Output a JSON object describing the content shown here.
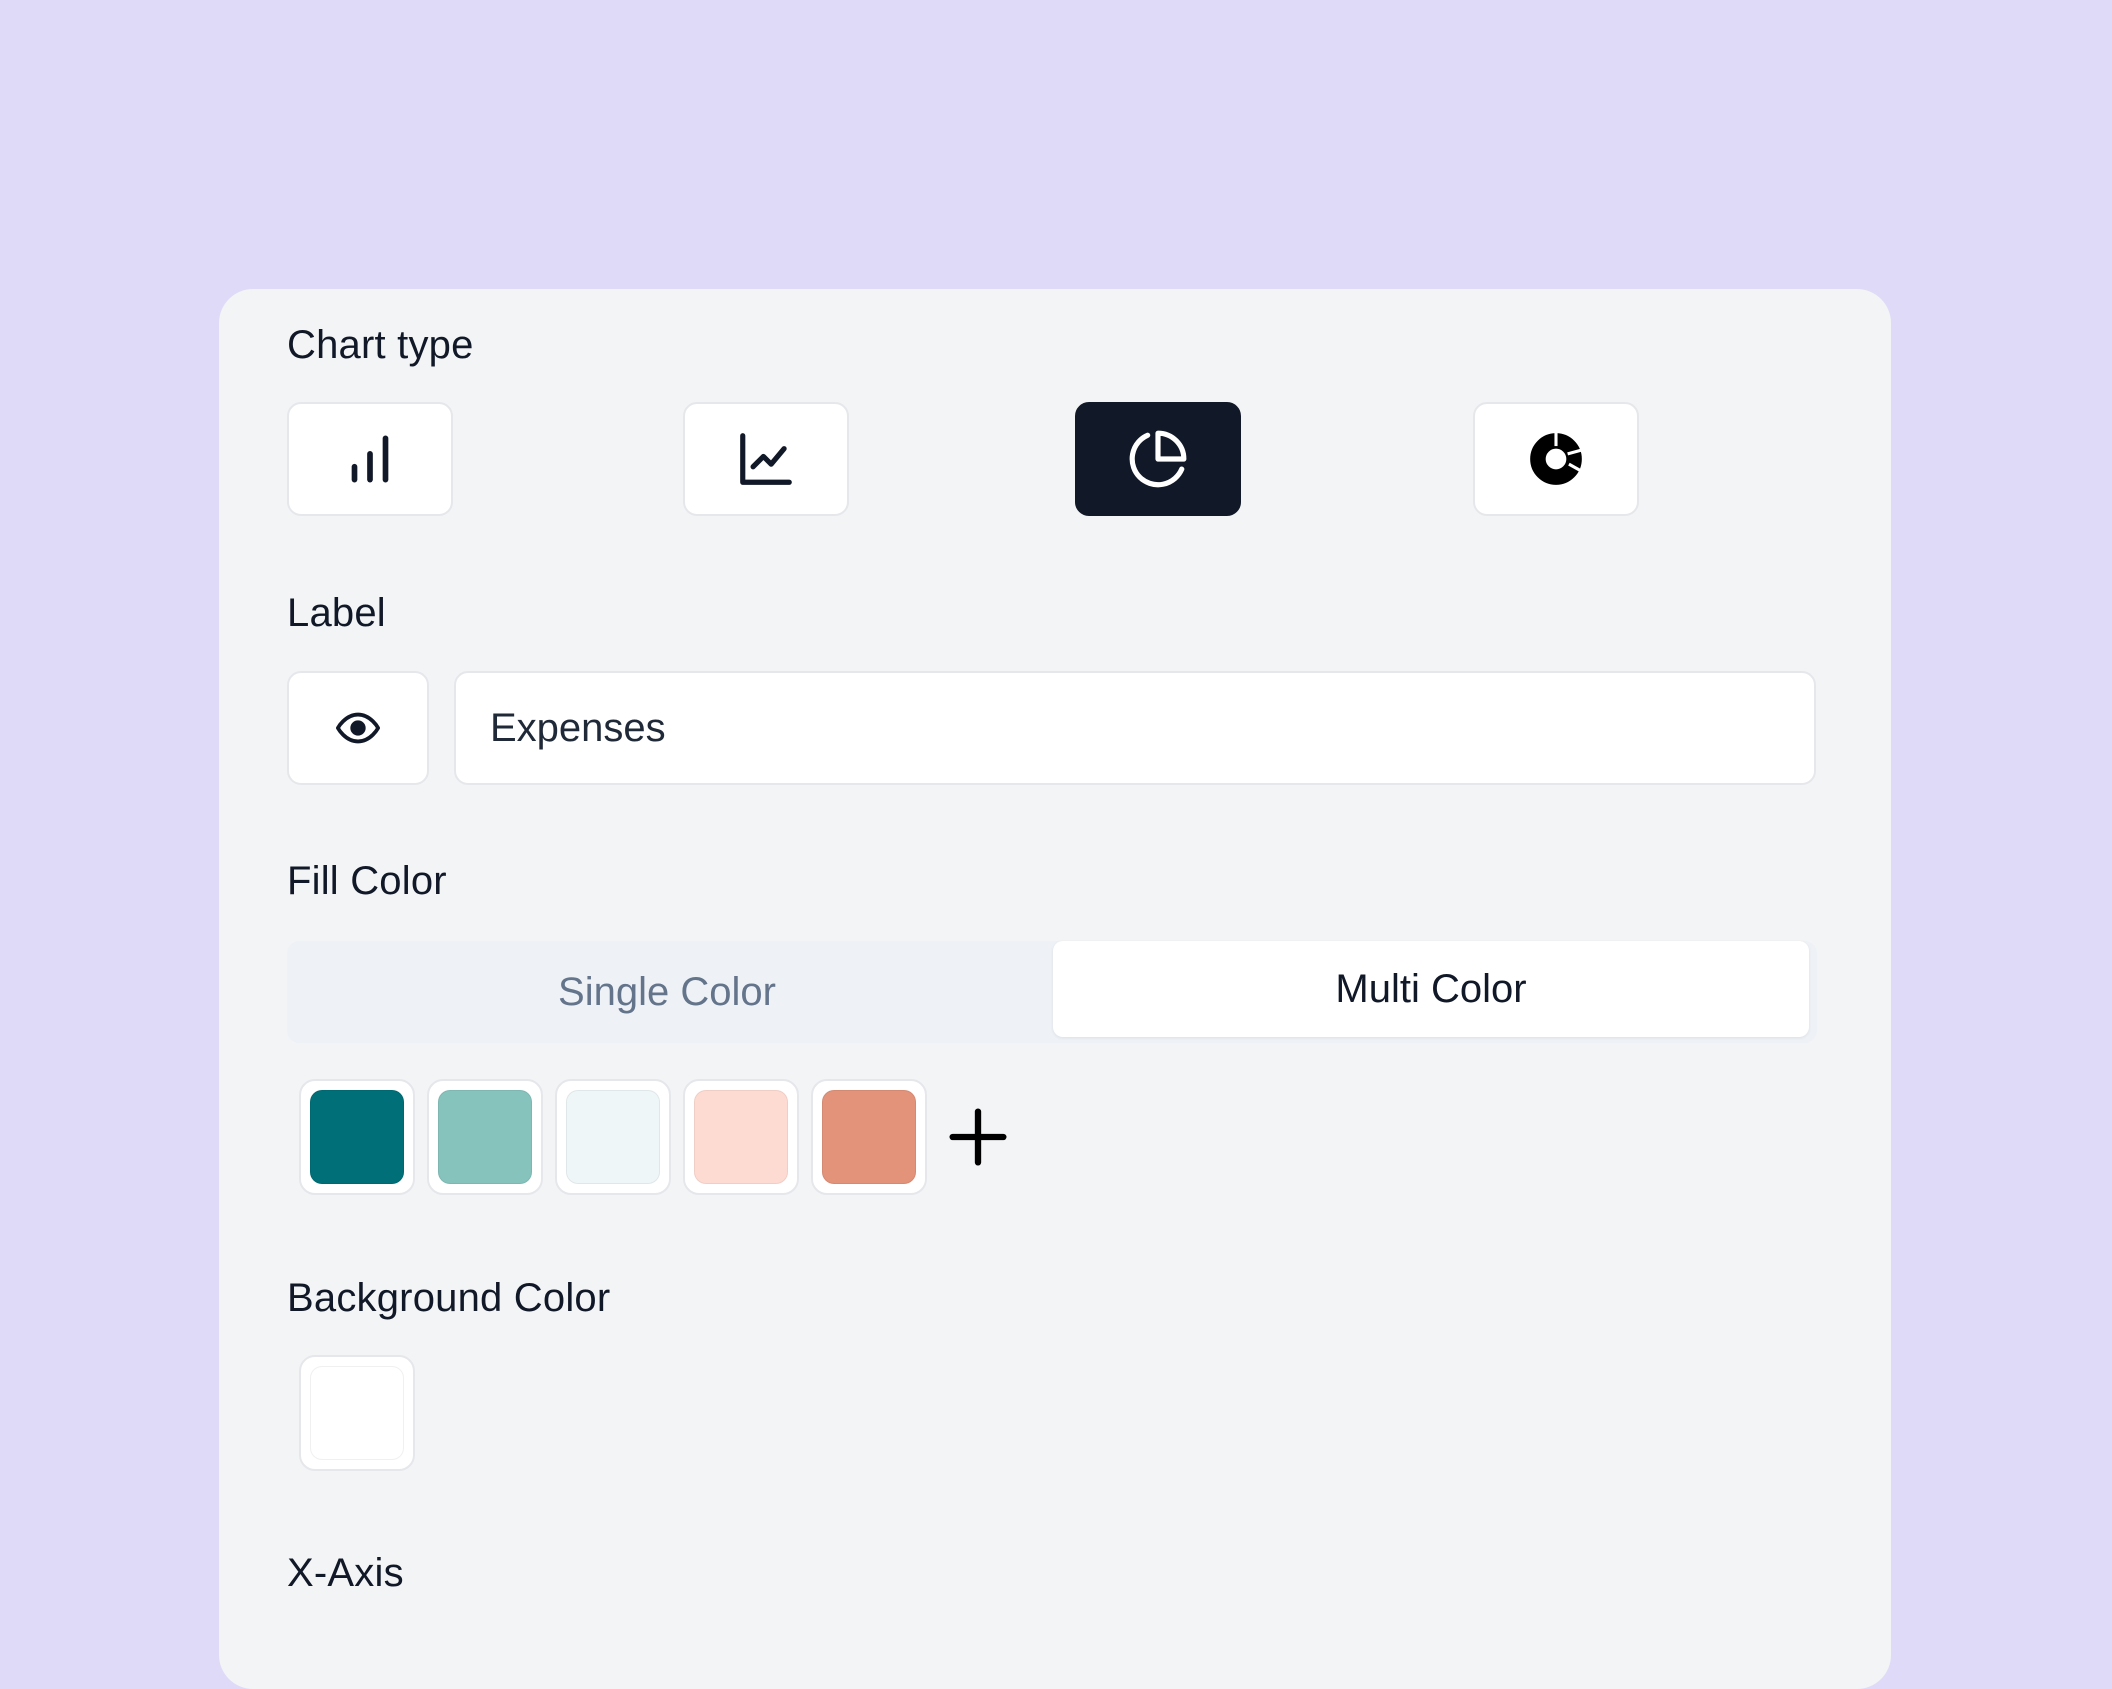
{
  "sections": {
    "chart_type": "Chart type",
    "label": "Label",
    "fill_color": "Fill Color",
    "background_color": "Background Color",
    "x_axis": "X-Axis"
  },
  "chart_types": [
    {
      "name": "bar",
      "icon": "bar-chart-icon",
      "active": false
    },
    {
      "name": "line",
      "icon": "line-chart-icon",
      "active": false
    },
    {
      "name": "pie",
      "icon": "pie-chart-icon",
      "active": true
    },
    {
      "name": "donut",
      "icon": "donut-chart-icon",
      "active": false
    }
  ],
  "label_field": {
    "value": "Expenses",
    "visibility_icon": "eye-icon"
  },
  "fill_mode": {
    "options": [
      "Single Color",
      "Multi Color"
    ],
    "selected": "Multi Color"
  },
  "fill_colors": [
    "#006f78",
    "#86c3bd",
    "#eef6f8",
    "#fedbd2",
    "#e2937a"
  ],
  "add_color_icon": "plus-icon",
  "background_color": "#ffffff",
  "theme": {
    "page_bg": "#dedaf7",
    "panel_bg": "#f3f4f6",
    "active_button_bg": "#111827"
  }
}
